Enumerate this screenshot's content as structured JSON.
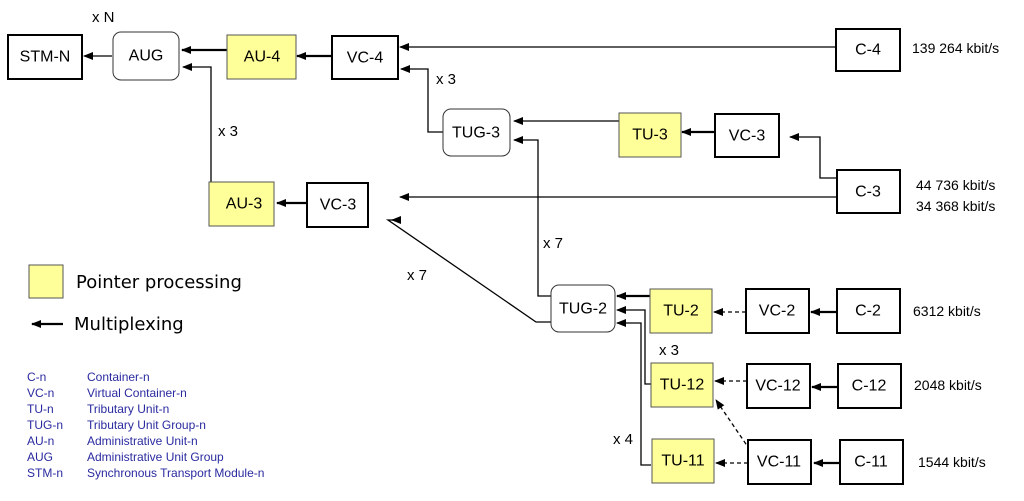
{
  "nodes": {
    "stm_n": "STM-N",
    "aug": "AUG",
    "au4": "AU-4",
    "vc4": "VC-4",
    "c4": "C-4",
    "tug3": "TUG-3",
    "tu3": "TU-3",
    "vc3_top": "VC-3",
    "c3": "C-3",
    "au3": "AU-3",
    "vc3_mid": "VC-3",
    "tug2": "TUG-2",
    "tu2": "TU-2",
    "vc2": "VC-2",
    "c2": "C-2",
    "tu12": "TU-12",
    "vc12": "VC-12",
    "c12": "C-12",
    "tu11": "TU-11",
    "vc11": "VC-11",
    "c11": "C-11"
  },
  "multipliers": {
    "xN": "x N",
    "x3_aug": "x 3",
    "x3_tug3": "x 3",
    "x7_tug3": "x 7",
    "x7_vc3": "x 7",
    "x3_tu12": "x 3",
    "x4_tu11": "x 4"
  },
  "rates": {
    "c4": "139 264 kbit/s",
    "c3_a": "44 736 kbit/s",
    "c3_b": "34 368 kbit/s",
    "c2": "6312 kbit/s",
    "c12": "2048 kbit/s",
    "c11": "1544 kbit/s"
  },
  "legend": {
    "pointer_processing": "Pointer processing",
    "multiplexing": "Multiplexing",
    "pointer_color": "#ffff99"
  },
  "abbreviations": [
    {
      "abbr": "C-n",
      "meaning": "Container-n"
    },
    {
      "abbr": "VC-n",
      "meaning": "Virtual Container-n"
    },
    {
      "abbr": "TU-n",
      "meaning": "Tributary Unit-n"
    },
    {
      "abbr": "TUG-n",
      "meaning": "Tributary Unit Group-n"
    },
    {
      "abbr": "AU-n",
      "meaning": "Administrative Unit-n"
    },
    {
      "abbr": "AUG",
      "meaning": "Administrative Unit Group"
    },
    {
      "abbr": "STM-n",
      "meaning": "Synchronous Transport Module-n"
    }
  ]
}
